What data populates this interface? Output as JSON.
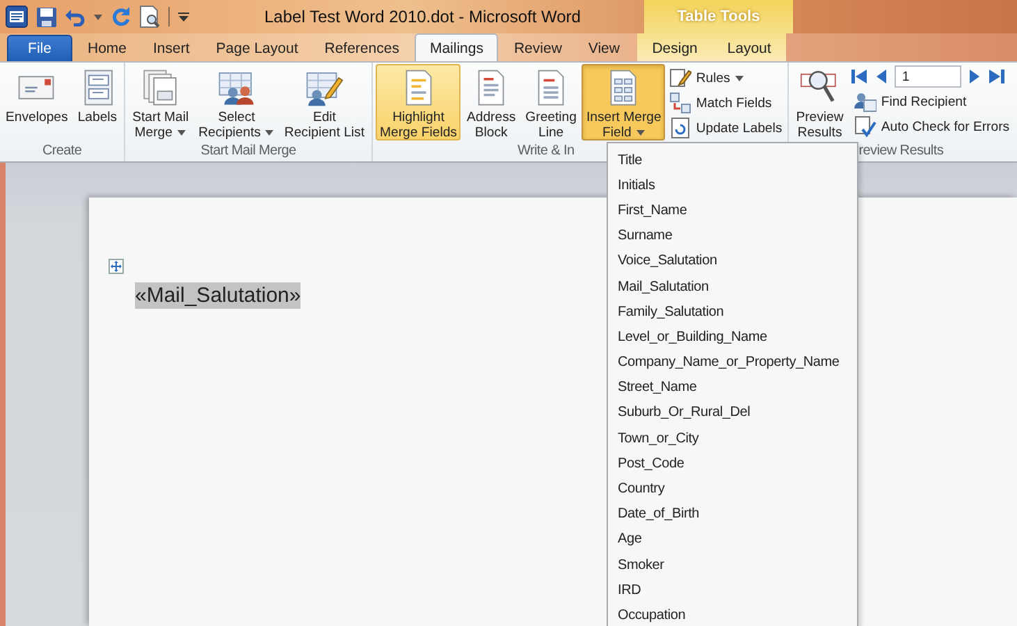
{
  "window": {
    "title": "Label Test Word 2010.dot - Microsoft Word"
  },
  "contextual_group": {
    "label": "Table Tools"
  },
  "tabs": [
    {
      "label": "File",
      "kind": "file",
      "selected": false
    },
    {
      "label": "Home",
      "kind": "standard",
      "selected": false
    },
    {
      "label": "Insert",
      "kind": "standard",
      "selected": false
    },
    {
      "label": "Page Layout",
      "kind": "standard",
      "selected": false
    },
    {
      "label": "References",
      "kind": "standard",
      "selected": false
    },
    {
      "label": "Mailings",
      "kind": "standard",
      "selected": true
    },
    {
      "label": "Review",
      "kind": "standard",
      "selected": false
    },
    {
      "label": "View",
      "kind": "standard",
      "selected": false
    },
    {
      "label": "Design",
      "kind": "contextual",
      "selected": false
    },
    {
      "label": "Layout",
      "kind": "contextual",
      "selected": false
    }
  ],
  "ribbon": {
    "groups": [
      {
        "label": "Create",
        "items": [
          {
            "kind": "large",
            "lines": [
              "Envelopes"
            ],
            "menu": false,
            "on": false,
            "expanded": false
          },
          {
            "kind": "large",
            "lines": [
              "Labels"
            ],
            "menu": false,
            "on": false,
            "expanded": false
          }
        ]
      },
      {
        "label": "Start Mail Merge",
        "items": [
          {
            "kind": "large",
            "lines": [
              "Start Mail",
              "Merge"
            ],
            "menu": true,
            "on": false,
            "expanded": false
          },
          {
            "kind": "large",
            "lines": [
              "Select",
              "Recipients"
            ],
            "menu": true,
            "on": false,
            "expanded": false
          },
          {
            "kind": "large",
            "lines": [
              "Edit",
              "Recipient List"
            ],
            "menu": false,
            "on": false,
            "expanded": false
          }
        ]
      },
      {
        "label": "Write & In",
        "items": [
          {
            "kind": "large",
            "lines": [
              "Highlight",
              "Merge Fields"
            ],
            "menu": false,
            "on": true,
            "expanded": false
          },
          {
            "kind": "large",
            "lines": [
              "Address",
              "Block"
            ],
            "menu": false,
            "on": false,
            "expanded": false
          },
          {
            "kind": "large",
            "lines": [
              "Greeting",
              "Line"
            ],
            "menu": false,
            "on": false,
            "expanded": false
          },
          {
            "kind": "large",
            "lines": [
              "Insert Merge",
              "Field"
            ],
            "menu": true,
            "on": false,
            "expanded": true
          },
          {
            "kind": "stack",
            "buttons": [
              {
                "label": "Rules",
                "menu": true
              },
              {
                "label": "Match Fields",
                "menu": false
              },
              {
                "label": "Update Labels",
                "menu": false
              }
            ]
          }
        ]
      },
      {
        "label": "review Results",
        "items": [
          {
            "kind": "large",
            "lines": [
              "Preview",
              "Results"
            ],
            "menu": false,
            "on": false,
            "expanded": false
          },
          {
            "kind": "navigator",
            "record": "1",
            "buttons": [
              {
                "label": "Find Recipient",
                "menu": false
              },
              {
                "label": "Auto Check for Errors",
                "menu": false
              }
            ]
          }
        ]
      }
    ]
  },
  "document": {
    "merge_field": "«Mail_Salutation»"
  },
  "merge_field_menu": {
    "items": [
      "Title",
      "Initials",
      "First_Name",
      "Surname",
      "Voice_Salutation",
      "Mail_Salutation",
      "Family_Salutation",
      "Level_or_Building_Name",
      "Company_Name_or_Property_Name",
      "Street_Name",
      "Suburb_Or_Rural_Del",
      "Town_or_City",
      "Post_Code",
      "Country",
      "Date_of_Birth",
      "Age",
      "Smoker",
      "IRD",
      "Occupation"
    ]
  }
}
